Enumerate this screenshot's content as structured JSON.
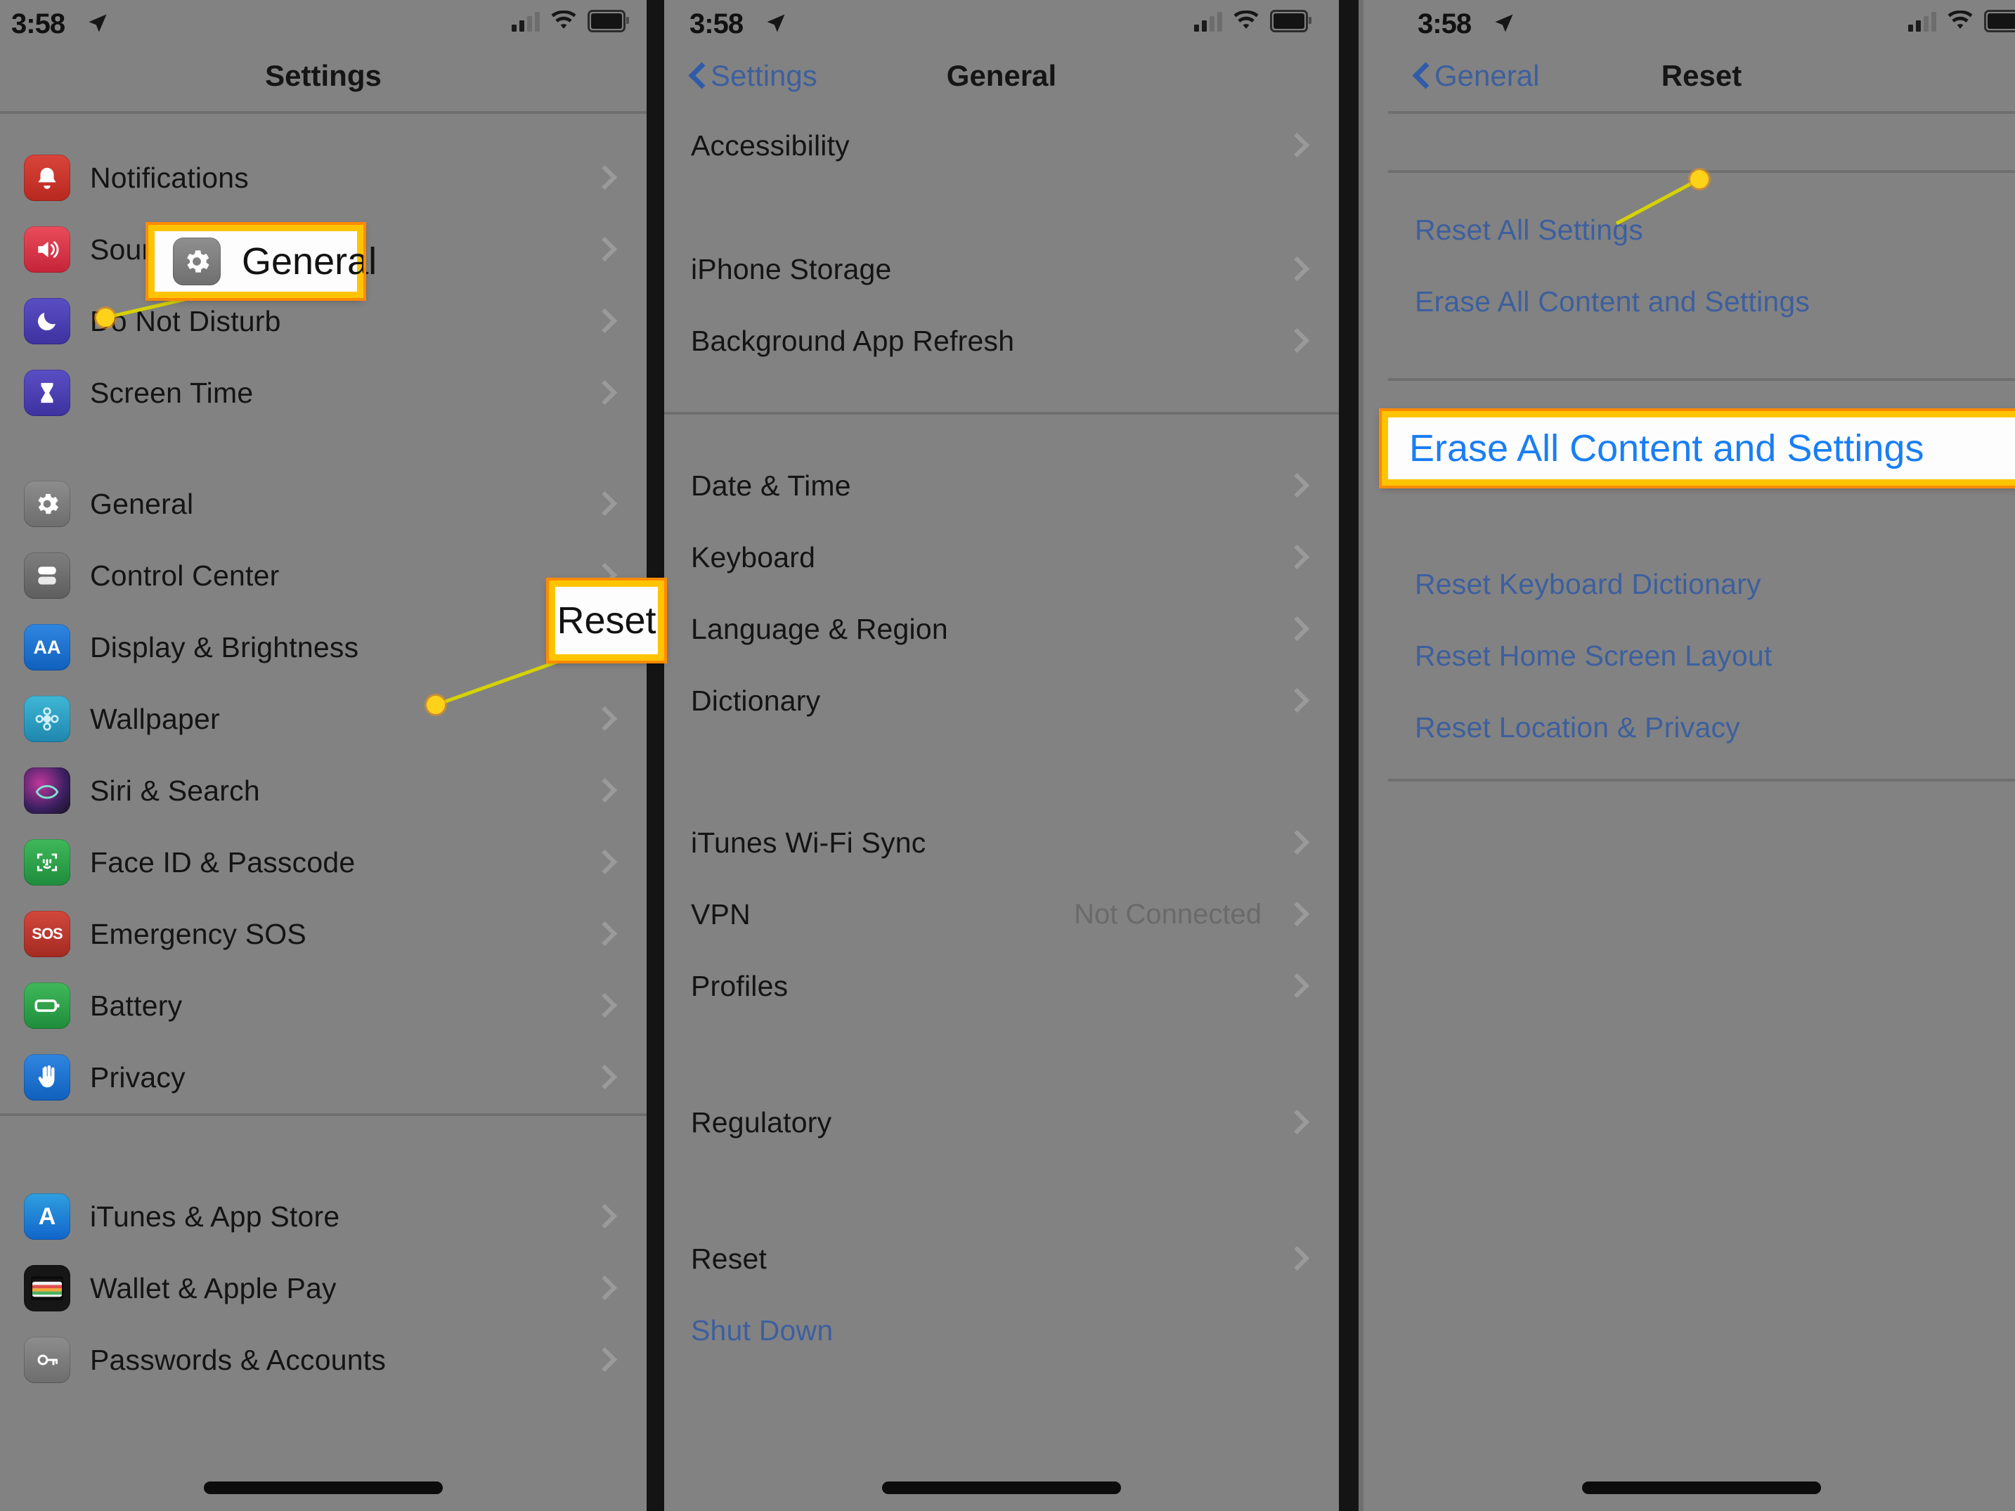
{
  "status": {
    "time": "3:58",
    "icons": [
      "location-arrow-icon",
      "cellular-signal-icon",
      "wifi-icon",
      "battery-icon"
    ]
  },
  "panel1": {
    "title": "Settings",
    "groups": [
      {
        "items": [
          {
            "label": "Notifications",
            "icon": "notifications-icon",
            "color": "#c0392b",
            "glyph": "",
            "chevron": true
          },
          {
            "label": "Sounds & Haptics",
            "icon": "sounds-haptics-icon",
            "color": "#d63b4b",
            "glyph": "",
            "chevron": true
          },
          {
            "label": "Do Not Disturb",
            "icon": "do-not-disturb-icon",
            "color": "#4b3fa8",
            "glyph": "",
            "chevron": true
          },
          {
            "label": "Screen Time",
            "icon": "screen-time-icon",
            "color": "#4b3fa8",
            "glyph": "",
            "chevron": true
          }
        ]
      },
      {
        "items": [
          {
            "label": "General",
            "icon": "gear-icon",
            "color": "#7d7d7d",
            "glyph": "",
            "chevron": true
          },
          {
            "label": "Control Center",
            "icon": "control-center-icon",
            "color": "#6e6e6e",
            "glyph": "",
            "chevron": true
          },
          {
            "label": "Display & Brightness",
            "icon": "display-brightness-icon",
            "color": "#1869c4",
            "glyph": "AA",
            "chevron": true
          },
          {
            "label": "Wallpaper",
            "icon": "wallpaper-icon",
            "color": "#2c9bc4",
            "glyph": "",
            "chevron": true
          },
          {
            "label": "Siri & Search",
            "icon": "siri-search-icon",
            "color": "#2a2a35",
            "glyph": "",
            "chevron": true
          },
          {
            "label": "Face ID & Passcode",
            "icon": "face-id-passcode-icon",
            "color": "#2f9e44",
            "glyph": "",
            "chevron": true
          },
          {
            "label": "Emergency SOS",
            "icon": "emergency-sos-icon",
            "color": "#b8352c",
            "glyph": "SOS",
            "chevron": true
          },
          {
            "label": "Battery",
            "icon": "battery-settings-icon",
            "color": "#2f9e44",
            "glyph": "",
            "chevron": true
          },
          {
            "label": "Privacy",
            "icon": "privacy-icon",
            "color": "#1b74d1",
            "glyph": "",
            "chevron": true
          }
        ]
      },
      {
        "items": [
          {
            "label": "iTunes & App Store",
            "icon": "app-store-icon",
            "color": "#1b74d1",
            "glyph": "A",
            "chevron": true
          },
          {
            "label": "Wallet & Apple Pay",
            "icon": "wallet-apple-pay-icon",
            "color": "#1a1a1a",
            "glyph": "",
            "chevron": true
          },
          {
            "label": "Passwords & Accounts",
            "icon": "passwords-accounts-icon",
            "color": "#7d7d7d",
            "glyph": "",
            "chevron": true
          }
        ]
      }
    ],
    "callout": {
      "label": "General",
      "icon": "gear-icon"
    }
  },
  "panel2": {
    "title": "General",
    "back_label": "Settings",
    "groups": [
      {
        "items": [
          {
            "label": "Accessibility",
            "chevron": true
          }
        ]
      },
      {
        "items": [
          {
            "label": "iPhone Storage",
            "chevron": true
          },
          {
            "label": "Background App Refresh",
            "chevron": true
          }
        ]
      },
      {
        "items": [
          {
            "label": "Date & Time",
            "chevron": true
          },
          {
            "label": "Keyboard",
            "chevron": true
          },
          {
            "label": "Language & Region",
            "chevron": true
          },
          {
            "label": "Dictionary",
            "chevron": true
          }
        ]
      },
      {
        "items": [
          {
            "label": "iTunes Wi-Fi Sync",
            "chevron": true
          },
          {
            "label": "VPN",
            "value": "Not Connected",
            "chevron": true
          },
          {
            "label": "Profiles",
            "chevron": true
          }
        ]
      },
      {
        "items": [
          {
            "label": "Regulatory",
            "chevron": true
          }
        ]
      },
      {
        "items": [
          {
            "label": "Reset",
            "chevron": true
          },
          {
            "label": "Shut Down",
            "link": true,
            "chevron": false
          }
        ]
      }
    ],
    "callout": {
      "label": "Reset"
    }
  },
  "panel3": {
    "title": "Reset",
    "back_label": "General",
    "groups": [
      {
        "items": [
          {
            "label": "Reset All Settings",
            "link": true
          },
          {
            "label": "Erase All Content and Settings",
            "link": true
          }
        ]
      },
      {
        "items": [
          {
            "label": "Reset Keyboard Dictionary",
            "link": true
          },
          {
            "label": "Reset Home Screen Layout",
            "link": true
          },
          {
            "label": "Reset Location & Privacy",
            "link": true
          }
        ]
      }
    ],
    "callout": {
      "label": "Erase All Content and Settings"
    }
  },
  "colors": {
    "background": "#828282",
    "separator": "#6f6f6f",
    "link": "#3d5f9e",
    "callout_border": "#ffc400",
    "callout_outline": "#ff8a00",
    "callout_text_blue": "#1a7ef5",
    "leader_line": "#d6d200",
    "dot": "#ffd21a"
  }
}
